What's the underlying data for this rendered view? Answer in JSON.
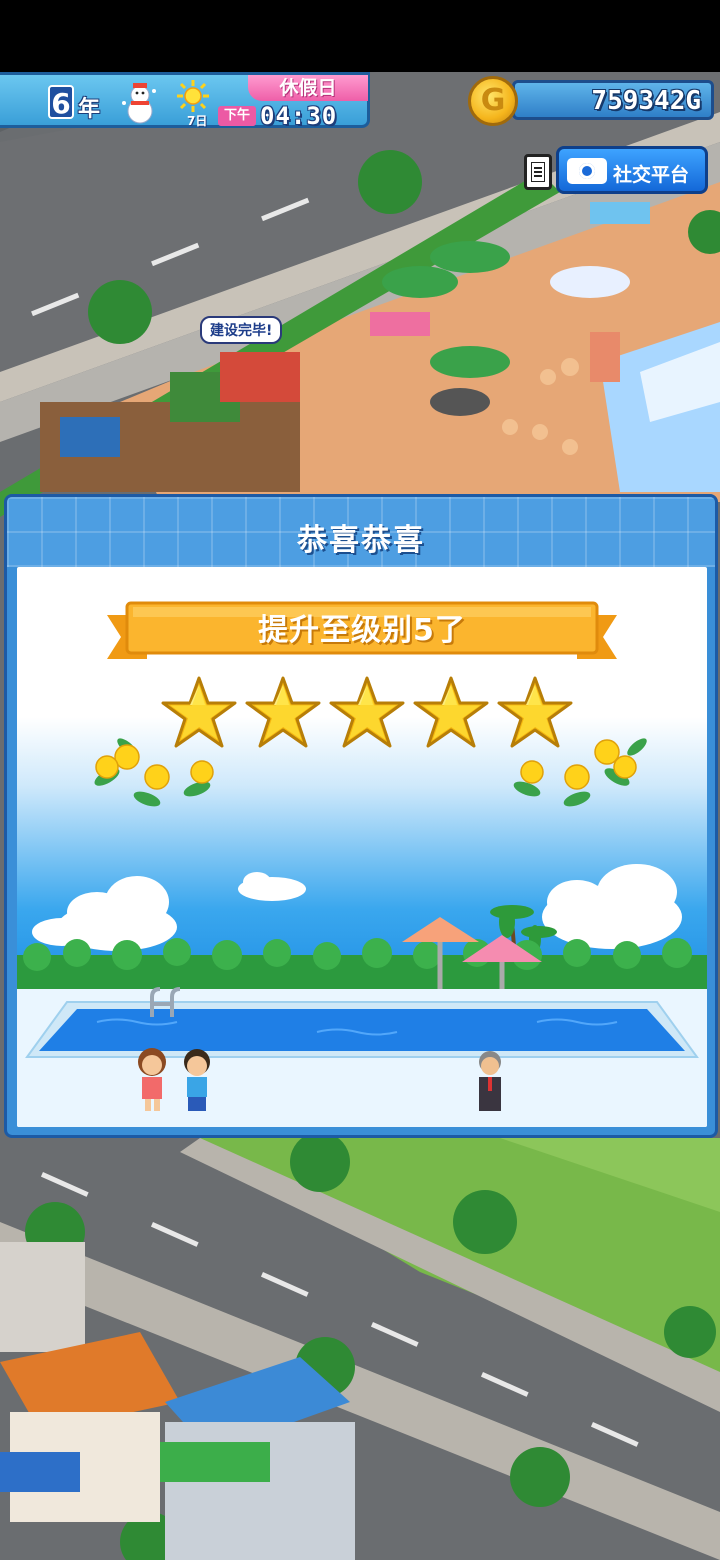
{
  "hud": {
    "year_number": "6",
    "year_label": "年",
    "day_label": "7日",
    "holiday_label": "休假日",
    "ampm_label": "下午",
    "time": "04:30"
  },
  "wallet": {
    "coin_symbol": "G",
    "money": "759342G"
  },
  "menu_button_icon": "menu-icon",
  "social": {
    "label": "社交平台",
    "icon": "camera-icon"
  },
  "world": {
    "built_bubble": "建设完毕!"
  },
  "dialog": {
    "title": "恭喜恭喜",
    "ribbon_text": "提升至级别5了",
    "stars": {
      "earned": 5,
      "total": 5
    }
  },
  "colors": {
    "dialog_blue": "#3a8fd8",
    "ribbon_orange": "#fbb52e",
    "star_yellow": "#ffe23a",
    "holiday_pink": "#ee5fa8",
    "social_blue": "#1f7ae6"
  }
}
